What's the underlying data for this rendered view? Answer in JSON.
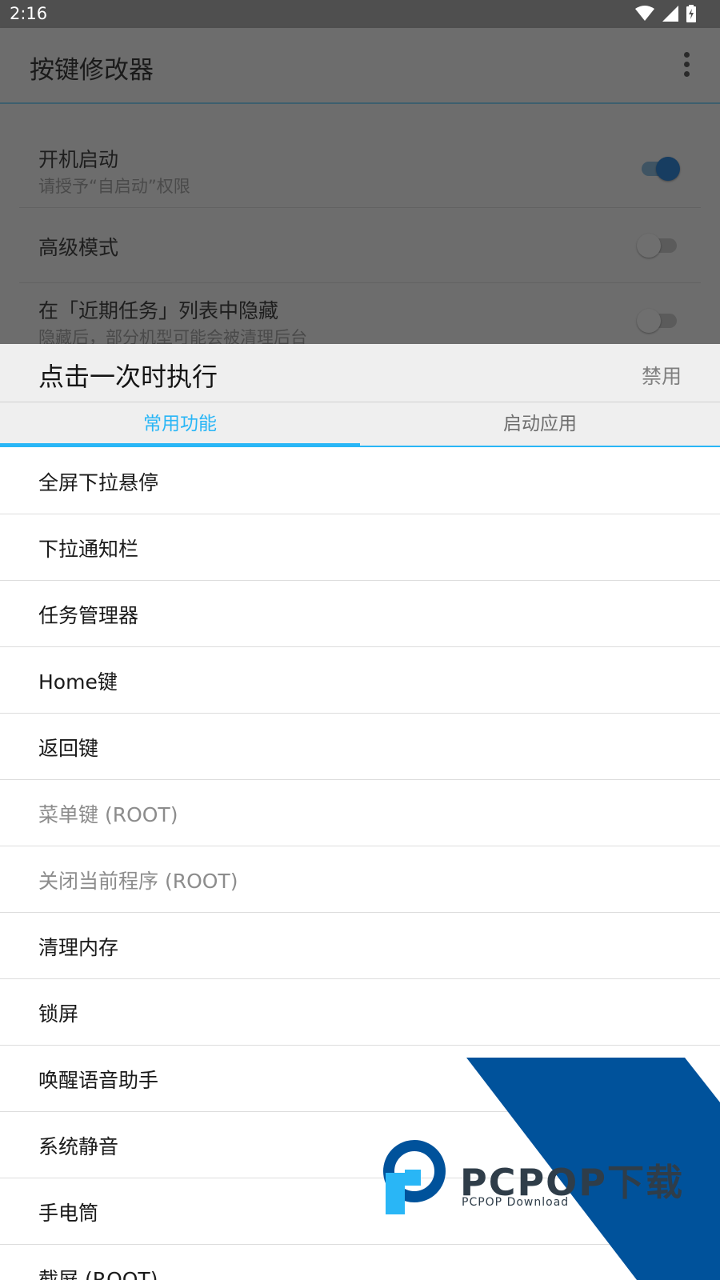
{
  "status_bar": {
    "time": "2:16",
    "icons": [
      "wifi-icon",
      "signal-icon",
      "battery-charging-icon"
    ]
  },
  "app_bar": {
    "title": "按键修改器",
    "menu_icon": "more-vert-icon"
  },
  "settings": [
    {
      "title": "开机启动",
      "subtitle": "请授予“自启动”权限",
      "switch_on": true
    },
    {
      "title": "高级模式",
      "subtitle": "",
      "switch_on": false
    },
    {
      "title": "在「近期任务」列表中隐藏",
      "subtitle": "隐藏后，部分机型可能会被清理后台",
      "switch_on": false
    }
  ],
  "sheet": {
    "title": "点击一次时执行",
    "disable_label": "禁用",
    "tabs": [
      {
        "label": "常用功能",
        "active": true
      },
      {
        "label": "启动应用",
        "active": false
      }
    ],
    "items": [
      {
        "label": "全屏下拉悬停",
        "enabled": true
      },
      {
        "label": "下拉通知栏",
        "enabled": true
      },
      {
        "label": "任务管理器",
        "enabled": true
      },
      {
        "label": "Home键",
        "enabled": true
      },
      {
        "label": "返回键",
        "enabled": true
      },
      {
        "label": "菜单键 (ROOT)",
        "enabled": false
      },
      {
        "label": "关闭当前程序 (ROOT)",
        "enabled": false
      },
      {
        "label": "清理内存",
        "enabled": true
      },
      {
        "label": "锁屏",
        "enabled": true
      },
      {
        "label": "唤醒语音助手",
        "enabled": true
      },
      {
        "label": "系统静音",
        "enabled": true
      },
      {
        "label": "手电筒",
        "enabled": true
      },
      {
        "label": "截屏 (ROOT)",
        "enabled": true
      }
    ]
  },
  "watermark": {
    "brand": "PCPOP下载",
    "sub": "PCPOP Download"
  },
  "colors": {
    "accent": "#29b6f6",
    "scrim_bg": "#6d6d6d",
    "watermark_blue": "#00529b"
  }
}
